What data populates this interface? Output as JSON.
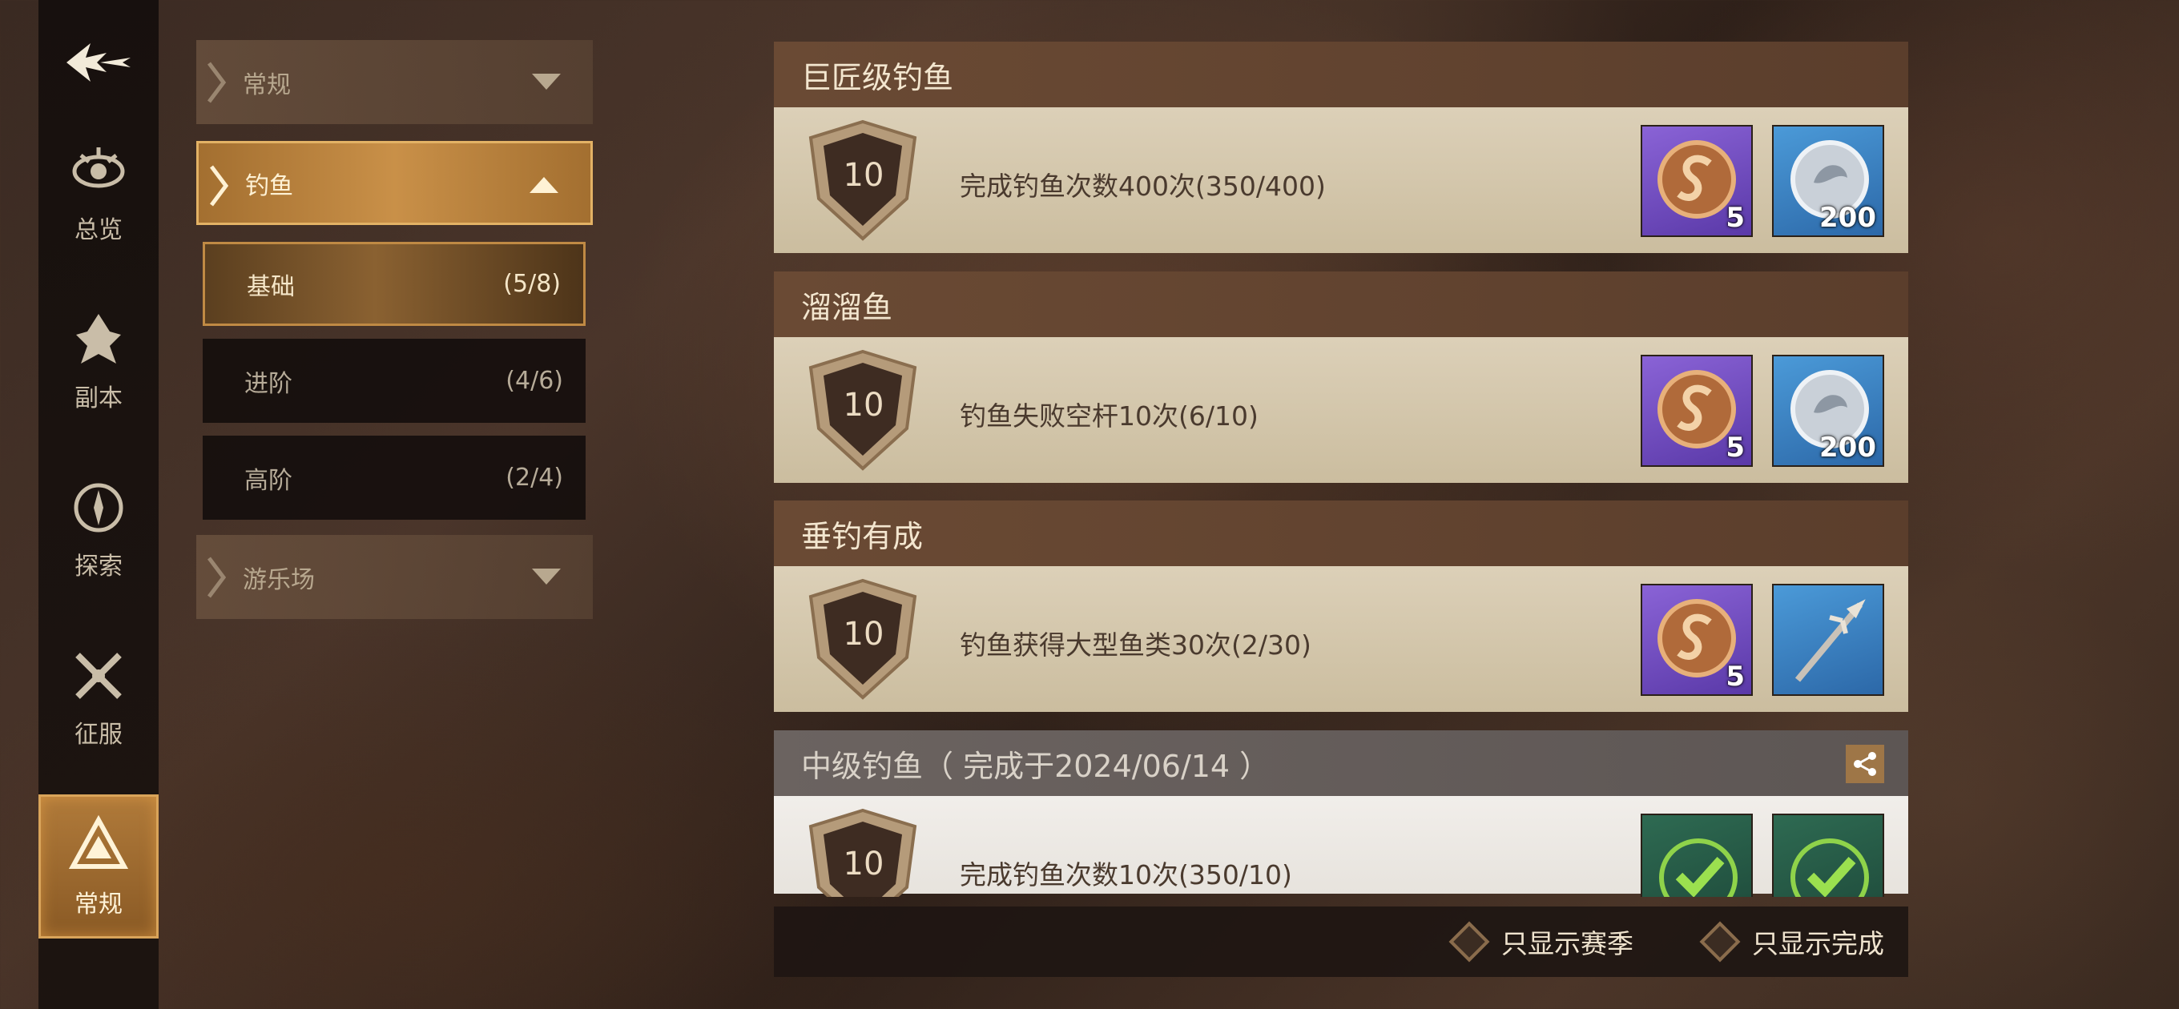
{
  "rail": {
    "items": [
      {
        "label": "总览",
        "icon": "eye-icon"
      },
      {
        "label": "副本",
        "icon": "flame-emblem-icon"
      },
      {
        "label": "探索",
        "icon": "compass-icon"
      },
      {
        "label": "征服",
        "icon": "crossed-swords-icon"
      },
      {
        "label": "常规",
        "icon": "triangle-emblem-icon",
        "active": true
      }
    ]
  },
  "categories": {
    "general": "常规",
    "fishing": "钓鱼",
    "subs": [
      {
        "label": "基础",
        "count": "(5/8)"
      },
      {
        "label": "进阶",
        "count": "(4/6)"
      },
      {
        "label": "高阶",
        "count": "(2/4)"
      }
    ],
    "playground": "游乐场"
  },
  "achievements": [
    {
      "title": "巨匠级钓鱼",
      "level": "10",
      "desc": "完成钓鱼次数400次(350/400)",
      "rewards": [
        {
          "type": "coin",
          "qty": "5"
        },
        {
          "type": "silver-medal",
          "qty": "200"
        }
      ]
    },
    {
      "title": "溜溜鱼",
      "level": "10",
      "desc": "钓鱼失败空杆10次(6/10)",
      "rewards": [
        {
          "type": "coin",
          "qty": "5"
        },
        {
          "type": "silver-medal",
          "qty": "200"
        }
      ]
    },
    {
      "title": "垂钓有成",
      "level": "10",
      "desc": "钓鱼获得大型鱼类30次(2/30)",
      "rewards": [
        {
          "type": "coin",
          "qty": "5"
        },
        {
          "type": "harpoon",
          "qty": ""
        }
      ]
    },
    {
      "title": "中级钓鱼（ 完成于2024/06/14 ）",
      "level": "10",
      "desc": "完成钓鱼次数10次(350/10)",
      "rewards": [
        {
          "type": "claimed"
        },
        {
          "type": "claimed"
        }
      ]
    }
  ],
  "filters": {
    "season_only": "只显示赛季",
    "completed_only": "只显示完成"
  },
  "colors": {
    "accent_gold": "#c99048",
    "header_brown": "#6a4a34",
    "card_parchment": "#dcd0b8"
  }
}
